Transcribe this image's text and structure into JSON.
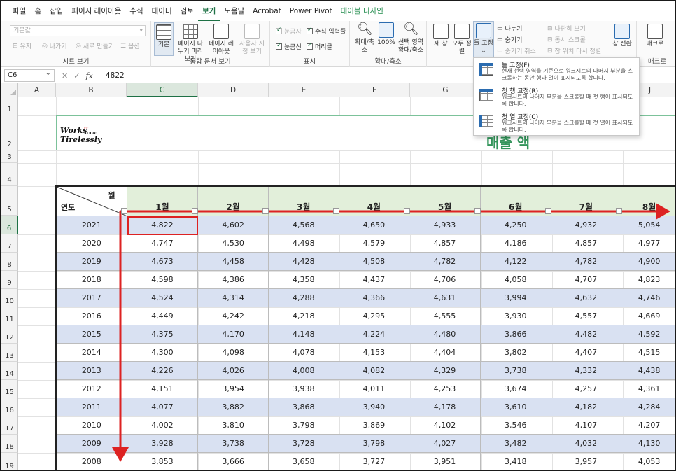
{
  "menu": {
    "tabs": [
      "파일",
      "홈",
      "삽입",
      "페이지 레이아웃",
      "수식",
      "데이터",
      "검토",
      "보기",
      "도움말",
      "Acrobat",
      "Power Pivot",
      "테이블 디자인"
    ],
    "active_tab": "보기"
  },
  "ribbon": {
    "view_dropdown": "기본값",
    "sheet_view": {
      "items": [
        "유지",
        "나가기",
        "새로 만들기",
        "옵션"
      ],
      "label": "시트 보기"
    },
    "workbook_views": {
      "buttons": [
        "기본",
        "페이지 나누기 미리 보기",
        "페이지 레이아웃",
        "사용자 지정 보기"
      ],
      "label": "통합 문서 보기"
    },
    "show": {
      "ruler": "눈금자",
      "formula_bar": "수식 입력줄",
      "gridlines": "눈금선",
      "headings": "머리글",
      "label": "표시"
    },
    "zoom": {
      "zoom": "확대/축소",
      "hundred": "100%",
      "selection": "선택 영역 확대/축소",
      "label": "확대/축소"
    },
    "window": {
      "new_window": "새 창",
      "arrange_all": "모두 정렬",
      "freeze_panes": "틀 고정",
      "split": "나누기",
      "hide": "숨기기",
      "unhide": "숨기기 취소",
      "side_by_side": "나란히 보기",
      "sync_scroll": "동시 스크롤",
      "reset_position": "창 위치 다시 정렬",
      "switch_windows": "창 전환",
      "label": "창"
    },
    "macros": {
      "macros": "매크로",
      "label": "매크로"
    }
  },
  "formula_bar": {
    "name_box": "C6",
    "cancel": "✕",
    "enter": "✓",
    "fx": "fx",
    "value": "4822"
  },
  "columns": [
    "A",
    "B",
    "C",
    "D",
    "E",
    "F",
    "G",
    "H",
    "I",
    "J"
  ],
  "rows": [
    "1",
    "2",
    "3",
    "4",
    "5",
    "6",
    "7",
    "8",
    "9",
    "10",
    "11",
    "12",
    "13",
    "14",
    "15",
    "16",
    "17",
    "18",
    "19"
  ],
  "title_box": {
    "logo_line1": "Works",
    "logo_line2": "Tirelessly",
    "logo_sup": "IT",
    "logo_audio": "AUDIO",
    "title_fragment": "매출 액"
  },
  "table": {
    "corner_month": "월",
    "corner_year": "연도",
    "months": [
      "1월",
      "2월",
      "3월",
      "4월",
      "5월",
      "6월",
      "7월",
      "8월"
    ],
    "rows": [
      {
        "year": "2021",
        "values": [
          "4,822",
          "4,602",
          "4,568",
          "4,650",
          "4,933",
          "4,250",
          "4,932",
          "5,054"
        ]
      },
      {
        "year": "2020",
        "values": [
          "4,747",
          "4,530",
          "4,498",
          "4,579",
          "4,857",
          "4,186",
          "4,857",
          "4,977"
        ]
      },
      {
        "year": "2019",
        "values": [
          "4,673",
          "4,458",
          "4,428",
          "4,508",
          "4,782",
          "4,122",
          "4,782",
          "4,900"
        ]
      },
      {
        "year": "2018",
        "values": [
          "4,598",
          "4,386",
          "4,358",
          "4,437",
          "4,706",
          "4,058",
          "4,707",
          "4,823"
        ]
      },
      {
        "year": "2017",
        "values": [
          "4,524",
          "4,314",
          "4,288",
          "4,366",
          "4,631",
          "3,994",
          "4,632",
          "4,746"
        ]
      },
      {
        "year": "2016",
        "values": [
          "4,449",
          "4,242",
          "4,218",
          "4,295",
          "4,555",
          "3,930",
          "4,557",
          "4,669"
        ]
      },
      {
        "year": "2015",
        "values": [
          "4,375",
          "4,170",
          "4,148",
          "4,224",
          "4,480",
          "3,866",
          "4,482",
          "4,592"
        ]
      },
      {
        "year": "2014",
        "values": [
          "4,300",
          "4,098",
          "4,078",
          "4,153",
          "4,404",
          "3,802",
          "4,407",
          "4,515"
        ]
      },
      {
        "year": "2013",
        "values": [
          "4,226",
          "4,026",
          "4,008",
          "4,082",
          "4,329",
          "3,738",
          "4,332",
          "4,438"
        ]
      },
      {
        "year": "2012",
        "values": [
          "4,151",
          "3,954",
          "3,938",
          "4,011",
          "4,253",
          "3,674",
          "4,257",
          "4,361"
        ]
      },
      {
        "year": "2011",
        "values": [
          "4,077",
          "3,882",
          "3,868",
          "3,940",
          "4,178",
          "3,610",
          "4,182",
          "4,284"
        ]
      },
      {
        "year": "2010",
        "values": [
          "4,002",
          "3,810",
          "3,798",
          "3,869",
          "4,102",
          "3,546",
          "4,107",
          "4,207"
        ]
      },
      {
        "year": "2009",
        "values": [
          "3,928",
          "3,738",
          "3,728",
          "3,798",
          "4,027",
          "3,482",
          "4,032",
          "4,130"
        ]
      },
      {
        "year": "2008",
        "values": [
          "3,853",
          "3,666",
          "3,658",
          "3,727",
          "3,951",
          "3,418",
          "3,957",
          "4,053"
        ]
      }
    ]
  },
  "dropdown": {
    "items": [
      {
        "title": "틀 고정(F)",
        "desc": "현재 선택 영역을 기준으로 워크시트의 나머지 부분을 스크롤하는 동안 행과 열이 표시되도록 합니다."
      },
      {
        "title": "첫 행 고정(R)",
        "desc": "워크시트의 나머지 부분을 스크롤할 때 첫 행이 표시되도록 합니다."
      },
      {
        "title": "첫 열 고정(C)",
        "desc": "워크시트의 나머지 부분을 스크롤할 때 첫 열이 표시되도록 합니다."
      }
    ]
  },
  "colors": {
    "accent_green": "#1e7145",
    "header_fill": "#e2efda",
    "alt_row_fill": "#d9e1f2",
    "arrow_red": "#d22222"
  }
}
